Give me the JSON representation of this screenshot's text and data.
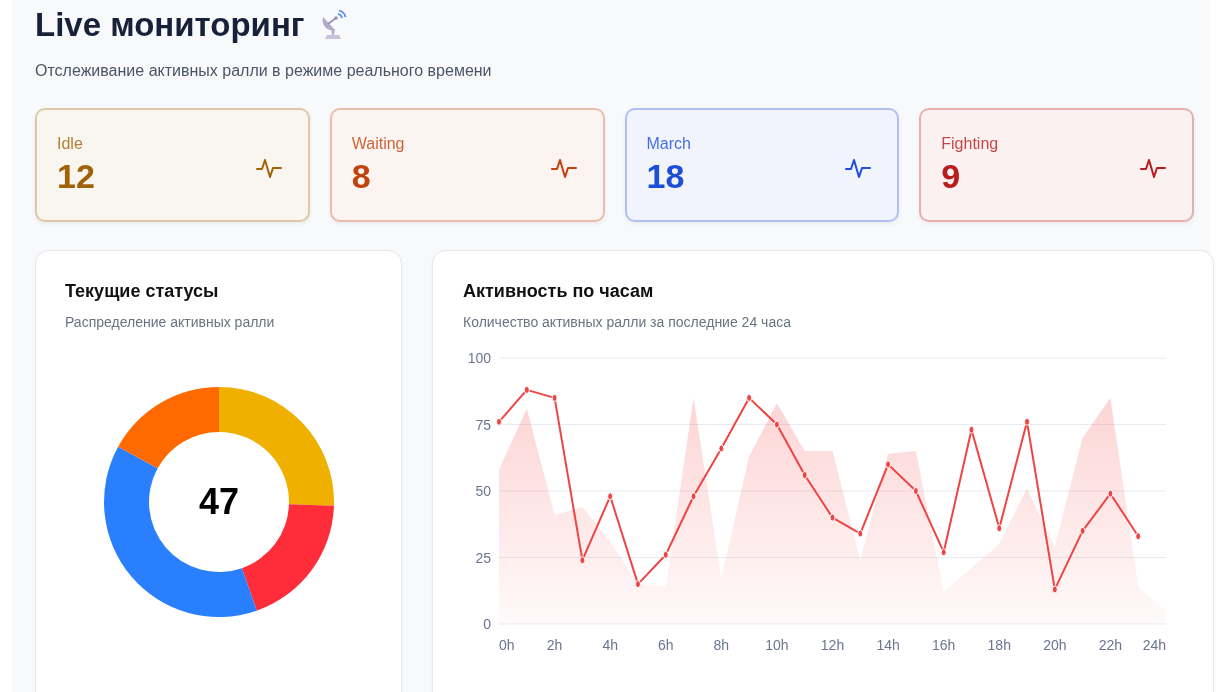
{
  "header": {
    "title": "Live мониторинг",
    "subtitle": "Отслеживание активных ралли в режиме реального времени"
  },
  "stats": [
    {
      "label": "Idle",
      "value": "12",
      "color": "#a16207"
    },
    {
      "label": "Waiting",
      "value": "8",
      "color": "#c2410c"
    },
    {
      "label": "March",
      "value": "18",
      "color": "#1d4ed8"
    },
    {
      "label": "Fighting",
      "value": "9",
      "color": "#b91c1c"
    }
  ],
  "status_card": {
    "title": "Текущие статусы",
    "subtitle": "Распределение активных ралли",
    "center_label": "47",
    "chart_data": {
      "type": "donut",
      "values": [
        25.53,
        19.15,
        38.3,
        17.02
      ],
      "colors": [
        "#efb000",
        "#ff2d3a",
        "#2a7fff",
        "#ff6a00"
      ]
    }
  },
  "activity_card": {
    "title": "Активность по часам",
    "subtitle": "Количество активных ралли за последние 24 часа",
    "chart_data": {
      "type": "line",
      "x": [
        0,
        1,
        2,
        3,
        4,
        5,
        6,
        7,
        8,
        9,
        10,
        11,
        12,
        13,
        14,
        15,
        16,
        17,
        18,
        19,
        20,
        21,
        22,
        23,
        24
      ],
      "ylim": [
        0,
        100
      ],
      "xlim": [
        0,
        24
      ],
      "grid": "y",
      "yticks": [
        0,
        25,
        50,
        75,
        100
      ],
      "xticks": [
        {
          "value": 0,
          "label": "0h"
        },
        {
          "value": 2,
          "label": "2h"
        },
        {
          "value": 4,
          "label": "4h"
        },
        {
          "value": 6,
          "label": "6h"
        },
        {
          "value": 8,
          "label": "8h"
        },
        {
          "value": 10,
          "label": "10h"
        },
        {
          "value": 12,
          "label": "12h"
        },
        {
          "value": 14,
          "label": "14h"
        },
        {
          "value": 16,
          "label": "16h"
        },
        {
          "value": 18,
          "label": "18h"
        },
        {
          "value": 20,
          "label": "20h"
        },
        {
          "value": 22,
          "label": "22h"
        },
        {
          "value": 24,
          "label": "24h"
        }
      ],
      "series": [
        {
          "type": "area",
          "color": "#f87171",
          "values": [
            58,
            81,
            41,
            44,
            31,
            15,
            14,
            85,
            17,
            63,
            83,
            65,
            65,
            24,
            64,
            65,
            12,
            21,
            30,
            51,
            29,
            70,
            85,
            14,
            5
          ]
        },
        {
          "type": "line",
          "marker": "circle",
          "color": "#ef4444",
          "values": [
            76,
            88,
            85,
            24,
            48,
            15,
            26,
            48,
            66,
            85,
            75,
            56,
            40,
            34,
            60,
            50,
            27,
            73,
            36,
            76,
            13,
            35,
            49,
            33,
            null
          ]
        }
      ]
    }
  }
}
